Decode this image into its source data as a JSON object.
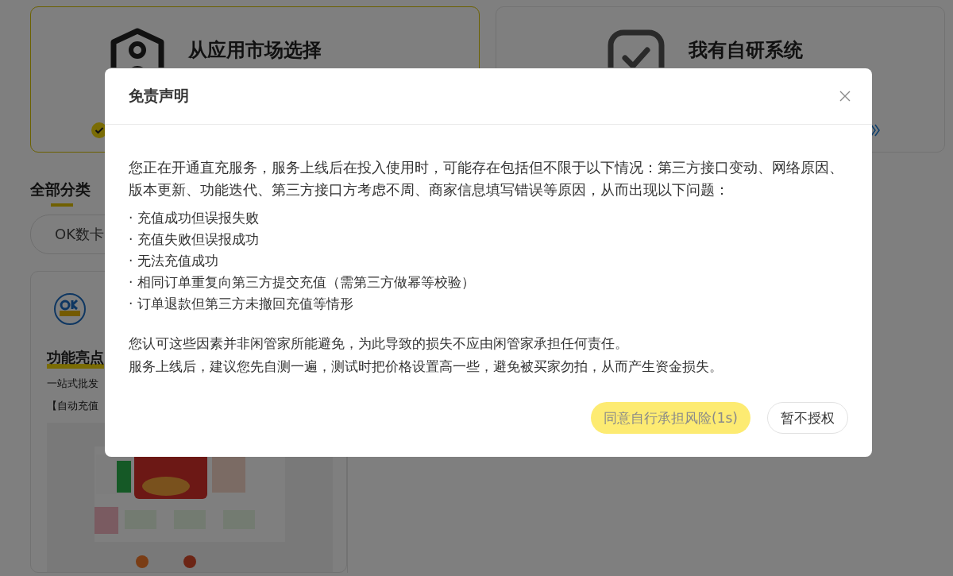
{
  "options": [
    {
      "title": "从应用市场选择",
      "selected": true
    },
    {
      "title": "我有自研系统",
      "selected": false
    }
  ],
  "category_tab": {
    "label": "全部分类",
    "selected": true
  },
  "filter_chip": {
    "label": "OK数卡"
  },
  "app_card": {
    "section_title": "功能亮点",
    "lines": [
      "一站式批发",
      "【自动充值"
    ]
  },
  "dialog": {
    "title": "免责声明",
    "intro": "您正在开通直充服务，服务上线后在投入使用时，可能存在包括但不限于以下情况：第三方接口变动、网络原因、版本更新、功能迭代、第三方接口方考虑不周、商家信息填写错误等原因，从而出现以下问题：",
    "items": [
      "· 充值成功但误报失败",
      "· 充值失败但误报成功",
      "· 无法充值成功",
      "· 相同订单重复向第三方提交充值（需第三方做幂等校验）",
      "· 订单退款但第三方未撤回充值等情形"
    ],
    "notes": [
      "您认可这些因素并非闲管家所能避免，为此导致的损失不应由闲管家承担任何责任。",
      "服务上线后，建议您先自测一遍，测试时把价格设置高一些，避免被买家勿拍，从而产生资金损失。"
    ],
    "buttons": [
      {
        "label": "同意自行承担风险(1s)",
        "kind": "primary",
        "disabled": true
      },
      {
        "label": "暂不授权",
        "kind": "secondary",
        "disabled": false
      }
    ]
  }
}
